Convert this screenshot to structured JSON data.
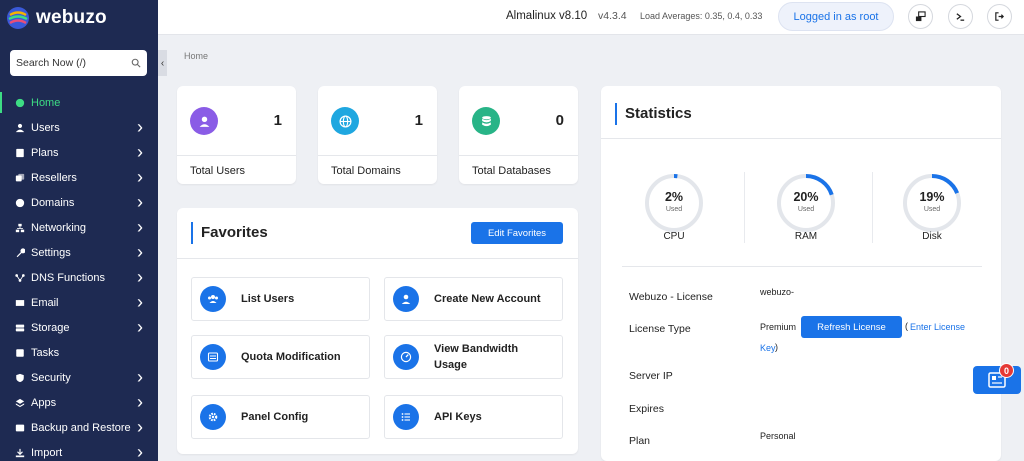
{
  "brand": {
    "name": "webuzo"
  },
  "search": {
    "placeholder": "Search Now (/)"
  },
  "sidebar": {
    "items": [
      {
        "label": "Home",
        "icon": "dashboard-icon",
        "active": true,
        "has_chevron": false
      },
      {
        "label": "Users",
        "icon": "user-icon",
        "has_chevron": true
      },
      {
        "label": "Plans",
        "icon": "plans-icon",
        "has_chevron": true
      },
      {
        "label": "Resellers",
        "icon": "resellers-icon",
        "has_chevron": true
      },
      {
        "label": "Domains",
        "icon": "globe-icon",
        "has_chevron": true
      },
      {
        "label": "Networking",
        "icon": "network-icon",
        "has_chevron": true
      },
      {
        "label": "Settings",
        "icon": "wrench-icon",
        "has_chevron": true
      },
      {
        "label": "DNS Functions",
        "icon": "dns-icon",
        "has_chevron": true
      },
      {
        "label": "Email",
        "icon": "envelope-icon",
        "has_chevron": true
      },
      {
        "label": "Storage",
        "icon": "storage-icon",
        "has_chevron": true
      },
      {
        "label": "Tasks",
        "icon": "tasks-icon",
        "has_chevron": false
      },
      {
        "label": "Security",
        "icon": "shield-icon",
        "has_chevron": true
      },
      {
        "label": "Apps",
        "icon": "apps-icon",
        "has_chevron": true
      },
      {
        "label": "Backup and Restore",
        "icon": "backup-icon",
        "has_chevron": true
      },
      {
        "label": "Import",
        "icon": "import-icon",
        "has_chevron": true
      }
    ]
  },
  "topbar": {
    "os": "Almalinux v8.10",
    "version": "v4.3.4",
    "load": "Load Averages: 0.35, 0.4, 0.33",
    "logged_in": "Logged in as root"
  },
  "breadcrumb": {
    "home": "Home"
  },
  "stats": [
    {
      "value": "1",
      "label": "Total Users",
      "color": "#8a5ce6",
      "icon": "user-icon"
    },
    {
      "value": "1",
      "label": "Total Domains",
      "color": "#1fa7e0",
      "icon": "globe-icon"
    },
    {
      "value": "0",
      "label": "Total Databases",
      "color": "#28b487",
      "icon": "database-icon"
    }
  ],
  "favorites": {
    "title": "Favorites",
    "edit_label": "Edit Favorites",
    "items": [
      {
        "label": "List Users",
        "icon": "users-icon"
      },
      {
        "label": "Create New Account",
        "icon": "user-circle-icon"
      },
      {
        "label": "Quota Modification",
        "icon": "list-icon"
      },
      {
        "label": "View Bandwidth Usage",
        "icon": "gauge-icon"
      },
      {
        "label": "Panel Config",
        "icon": "gear-icon"
      },
      {
        "label": "API Keys",
        "icon": "list-icon"
      }
    ]
  },
  "statistics": {
    "title": "Statistics",
    "gauges": [
      {
        "value": "2%",
        "percent": 2,
        "sub": "Used",
        "label": "CPU"
      },
      {
        "value": "20%",
        "percent": 20,
        "sub": "Used",
        "label": "RAM"
      },
      {
        "value": "19%",
        "percent": 19,
        "sub": "Used",
        "label": "Disk"
      }
    ],
    "license": {
      "webuzo_label": "Webuzo - License",
      "webuzo_value": "webuzo-",
      "type_label": "License Type",
      "type_value": "Premium",
      "refresh_label": "Refresh License",
      "paren_open": "(",
      "enter_label_a": "Enter License",
      "enter_label_b": "Key",
      "paren_close": ")",
      "server_ip_label": "Server IP",
      "expires_label": "Expires",
      "plan_label": "Plan",
      "plan_value": "Personal"
    }
  },
  "notification": {
    "count": "0"
  },
  "colors": {
    "sidebar": "#1e2a52",
    "accent": "#1a73e8",
    "active": "#3ddc84"
  }
}
